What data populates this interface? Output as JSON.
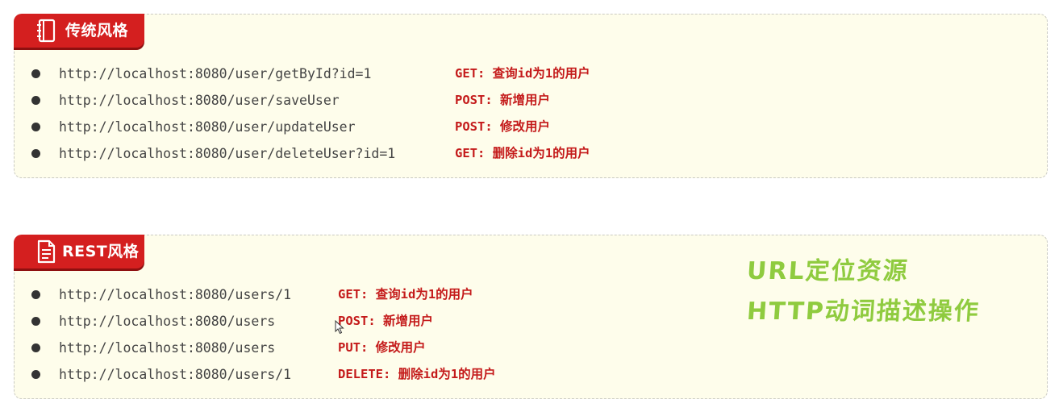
{
  "sections": [
    {
      "tab_label": "传统风格",
      "icon": "notebook-icon",
      "items": [
        {
          "url": "http://localhost:8080/user/getById?id=1",
          "desc": "GET: 查询id为1的用户"
        },
        {
          "url": "http://localhost:8080/user/saveUser",
          "desc": "POST: 新增用户"
        },
        {
          "url": "http://localhost:8080/user/updateUser",
          "desc": "POST: 修改用户"
        },
        {
          "url": "http://localhost:8080/user/deleteUser?id=1",
          "desc": "GET: 删除id为1的用户"
        }
      ]
    },
    {
      "tab_label": "REST风格",
      "icon": "document-icon",
      "items": [
        {
          "url": "http://localhost:8080/users/1",
          "desc": "GET: 查询id为1的用户"
        },
        {
          "url": "http://localhost:8080/users",
          "desc": "POST: 新增用户"
        },
        {
          "url": "http://localhost:8080/users",
          "desc": "PUT: 修改用户"
        },
        {
          "url": "http://localhost:8080/users/1",
          "desc": "DELETE: 删除id为1的用户"
        }
      ]
    }
  ],
  "annotation": {
    "line1": "URL定位资源",
    "line2": "HTTP动词描述操作"
  },
  "colors": {
    "tab_red": "#d41f1f",
    "desc_red": "#c41a1a",
    "panel_bg": "#fefdeb",
    "annotation_green": "#8fcb3f"
  }
}
